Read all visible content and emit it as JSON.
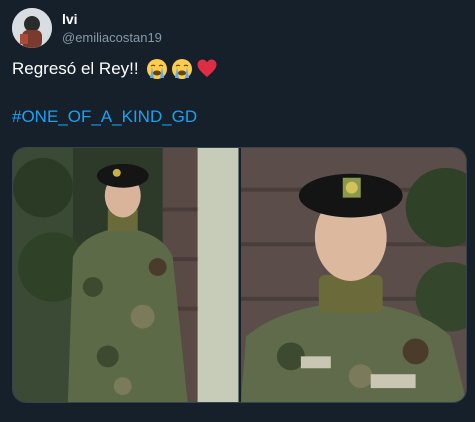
{
  "tweet": {
    "display_name": "lvi",
    "handle": "@emiliacostan19",
    "text": "Regresó el Rey!!",
    "emojis": [
      "crying-face-icon",
      "crying-face-icon",
      "red-heart-icon"
    ],
    "hashtag": "#ONE_OF_A_KIND_GD"
  },
  "colors": {
    "background": "#15202b",
    "text": "#ffffff",
    "secondary_text": "#8899a6",
    "link": "#1da1f2",
    "border": "#38444d"
  }
}
